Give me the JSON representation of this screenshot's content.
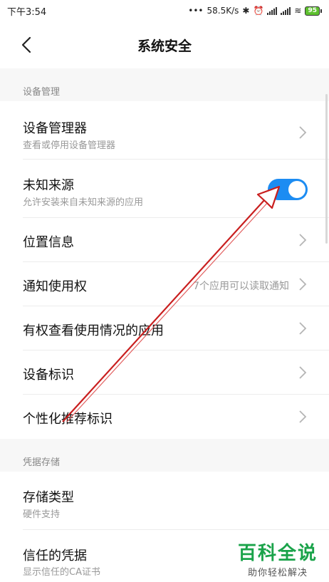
{
  "status_bar": {
    "time": "下午3:54",
    "network_speed": "58.5K/s",
    "battery": "95"
  },
  "header": {
    "title": "系统安全"
  },
  "sections": [
    {
      "label": "设备管理"
    },
    {
      "label": "凭据存储"
    }
  ],
  "rows": [
    {
      "title": "设备管理器",
      "subtitle": "查看或停用设备管理器"
    },
    {
      "title": "未知来源",
      "subtitle": "允许安装来自未知来源的应用",
      "toggle_on": true
    },
    {
      "title": "位置信息"
    },
    {
      "title": "通知使用权",
      "value": "7个应用可以读取通知"
    },
    {
      "title": "有权查看使用情况的应用"
    },
    {
      "title": "设备标识"
    },
    {
      "title": "个性化推荐标识"
    },
    {
      "title": "存储类型",
      "subtitle": "硬件支持"
    },
    {
      "title": "信任的凭据",
      "subtitle": "显示信任的CA证书"
    }
  ],
  "watermark": {
    "main": "百科全说",
    "sub": "助你轻松解决"
  },
  "colors": {
    "toggle_on": "#1c8cf2",
    "annotation_arrow": "#d22a2a",
    "watermark_green": "#1aa34a"
  }
}
